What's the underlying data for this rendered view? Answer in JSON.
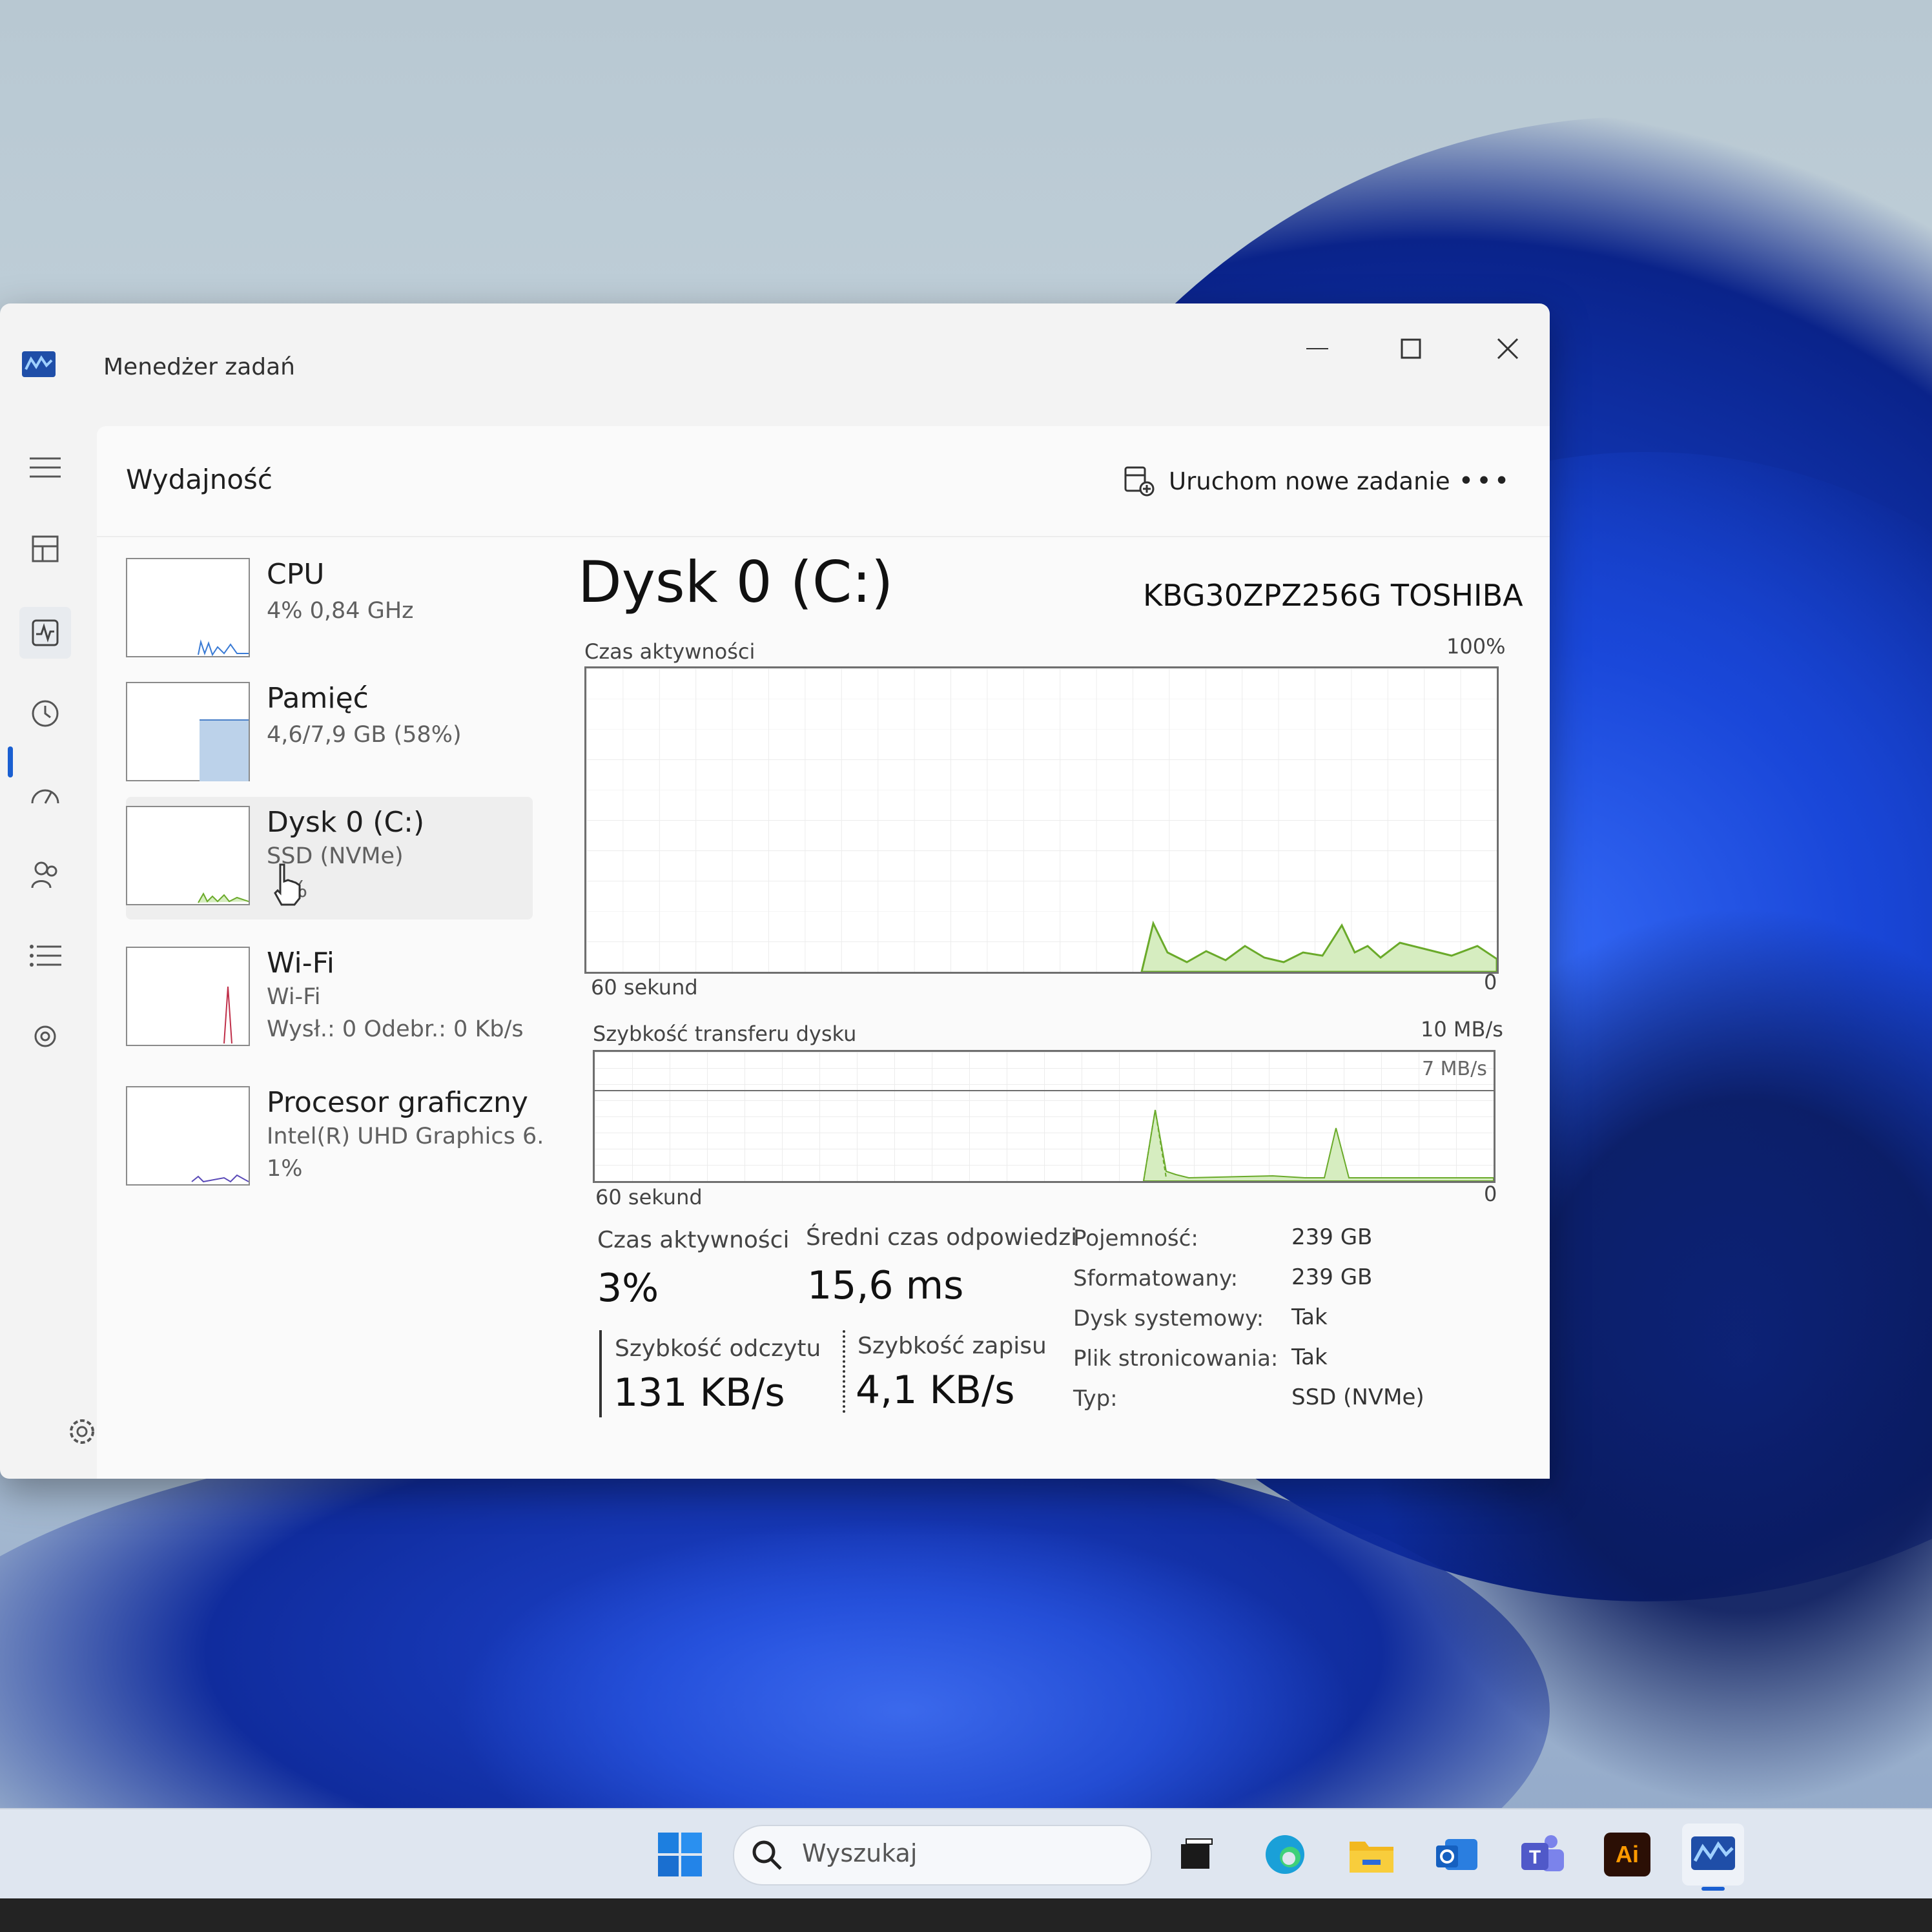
{
  "window": {
    "title": "Menedżer zadań"
  },
  "header": {
    "page_title": "Wydajność",
    "run_task_label": "Uruchom nowe zadanie",
    "more_label": "•••"
  },
  "perf_list": [
    {
      "name": "CPU",
      "line1": "4%  0,84 GHz",
      "line2": ""
    },
    {
      "name": "Pamięć",
      "line1": "4,6/7,9 GB (58%)",
      "line2": ""
    },
    {
      "name": "Dysk 0 (C:)",
      "line1": "SSD (NVMe)",
      "line2": "%"
    },
    {
      "name": "Wi-Fi",
      "line1": "Wi-Fi",
      "line2": "Wysł.: 0  Odebr.: 0 Kb/s"
    },
    {
      "name": "Procesor graficzny",
      "line1": "Intel(R) UHD Graphics 6.",
      "line2": "1%"
    }
  ],
  "detail": {
    "title": "Dysk 0 (C:)",
    "model": "KBG30ZPZ256G TOSHIBA",
    "graph1": {
      "label": "Czas aktywności",
      "max": "100%",
      "span": "60 sekund",
      "min": "0"
    },
    "graph2": {
      "label": "Szybkość transferu dysku",
      "max": "10 MB/s",
      "ref_line": "7 MB/s",
      "span": "60 sekund",
      "min": "0"
    },
    "stats": {
      "active_label": "Czas aktywności",
      "active_value": "3%",
      "resp_label": "Średni czas odpowiedzi",
      "resp_value": "15,6 ms",
      "read_label": "Szybkość odczytu",
      "read_value": "131 KB/s",
      "write_label": "Szybkość zapisu",
      "write_value": "4,1 KB/s"
    },
    "props": [
      {
        "label": "Pojemność:",
        "value": "239 GB"
      },
      {
        "label": "Sformatowany:",
        "value": "239 GB"
      },
      {
        "label": "Dysk systemowy:",
        "value": "Tak"
      },
      {
        "label": "Plik stronicowania:",
        "value": "Tak"
      },
      {
        "label": "Typ:",
        "value": "SSD (NVMe)"
      }
    ]
  },
  "taskbar": {
    "search_placeholder": "Wyszukaj",
    "adobe_label": "Ai"
  },
  "colors": {
    "accent": "#1a5fd1",
    "disk_graph": "#6aaa2a",
    "memory_fill": "#bcd2ea",
    "wifi_spike": "#c0304a"
  }
}
